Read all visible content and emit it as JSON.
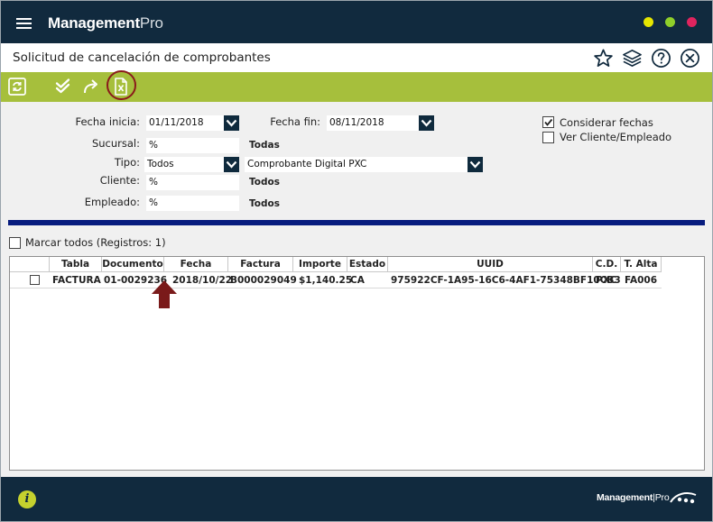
{
  "app": {
    "title_bold": "Management",
    "title_light": "Pro",
    "colors": {
      "titlebar": "#112a3e",
      "toolbar": "#a6bf3c",
      "dot_min": "#e6e600",
      "dot_max": "#8fcf2a",
      "dot_close": "#e0245e"
    }
  },
  "page": {
    "title": "Solicitud de cancelación de comprobantes",
    "header_icons": [
      "star-icon",
      "layers-icon",
      "help-icon",
      "close-circle-icon"
    ]
  },
  "toolbar": {
    "buttons": [
      "refresh-icon",
      "double-check-icon",
      "forward-icon",
      "cancel-document-icon"
    ]
  },
  "form": {
    "fecha_inicia_label": "Fecha inicia:",
    "fecha_inicia_value": "01/11/2018",
    "fecha_fin_label": "Fecha fin:",
    "fecha_fin_value": "08/11/2018",
    "sucursal_label": "Sucursal:",
    "sucursal_value": "%",
    "sucursal_desc": "Todas",
    "tipo_label": "Tipo:",
    "tipo_value": "Todos",
    "tipo_desc_value": "Comprobante Digital PXC",
    "cliente_label": "Cliente:",
    "cliente_value": "%",
    "cliente_desc": "Todos",
    "empleado_label": "Empleado:",
    "empleado_value": "%",
    "empleado_desc": "Todos",
    "considerar_fechas_label": "Considerar fechas",
    "considerar_fechas_checked": true,
    "ver_cliente_label": "Ver Cliente/Empleado",
    "ver_cliente_checked": false
  },
  "grid": {
    "marcar_todos_label": "Marcar todos (Registros: 1)",
    "headers": [
      "Tabla",
      "Documento",
      "Fecha",
      "Factura",
      "Importe",
      "Estado",
      "UUID",
      "C.D.",
      "T. Alta"
    ],
    "rows": [
      {
        "tabla": "FACTURA",
        "documento": "01-0029236",
        "fecha": "2018/10/22",
        "factura": "B000029049",
        "importe": "$1,140.25",
        "estado": "CA",
        "uuid": "975922CF-1A95-16C6-4AF1-75348BF10CB3",
        "cd": "PXC",
        "talta": "FA006"
      }
    ]
  },
  "footer": {
    "logo_bold": "Management",
    "logo_light": "Pro"
  }
}
